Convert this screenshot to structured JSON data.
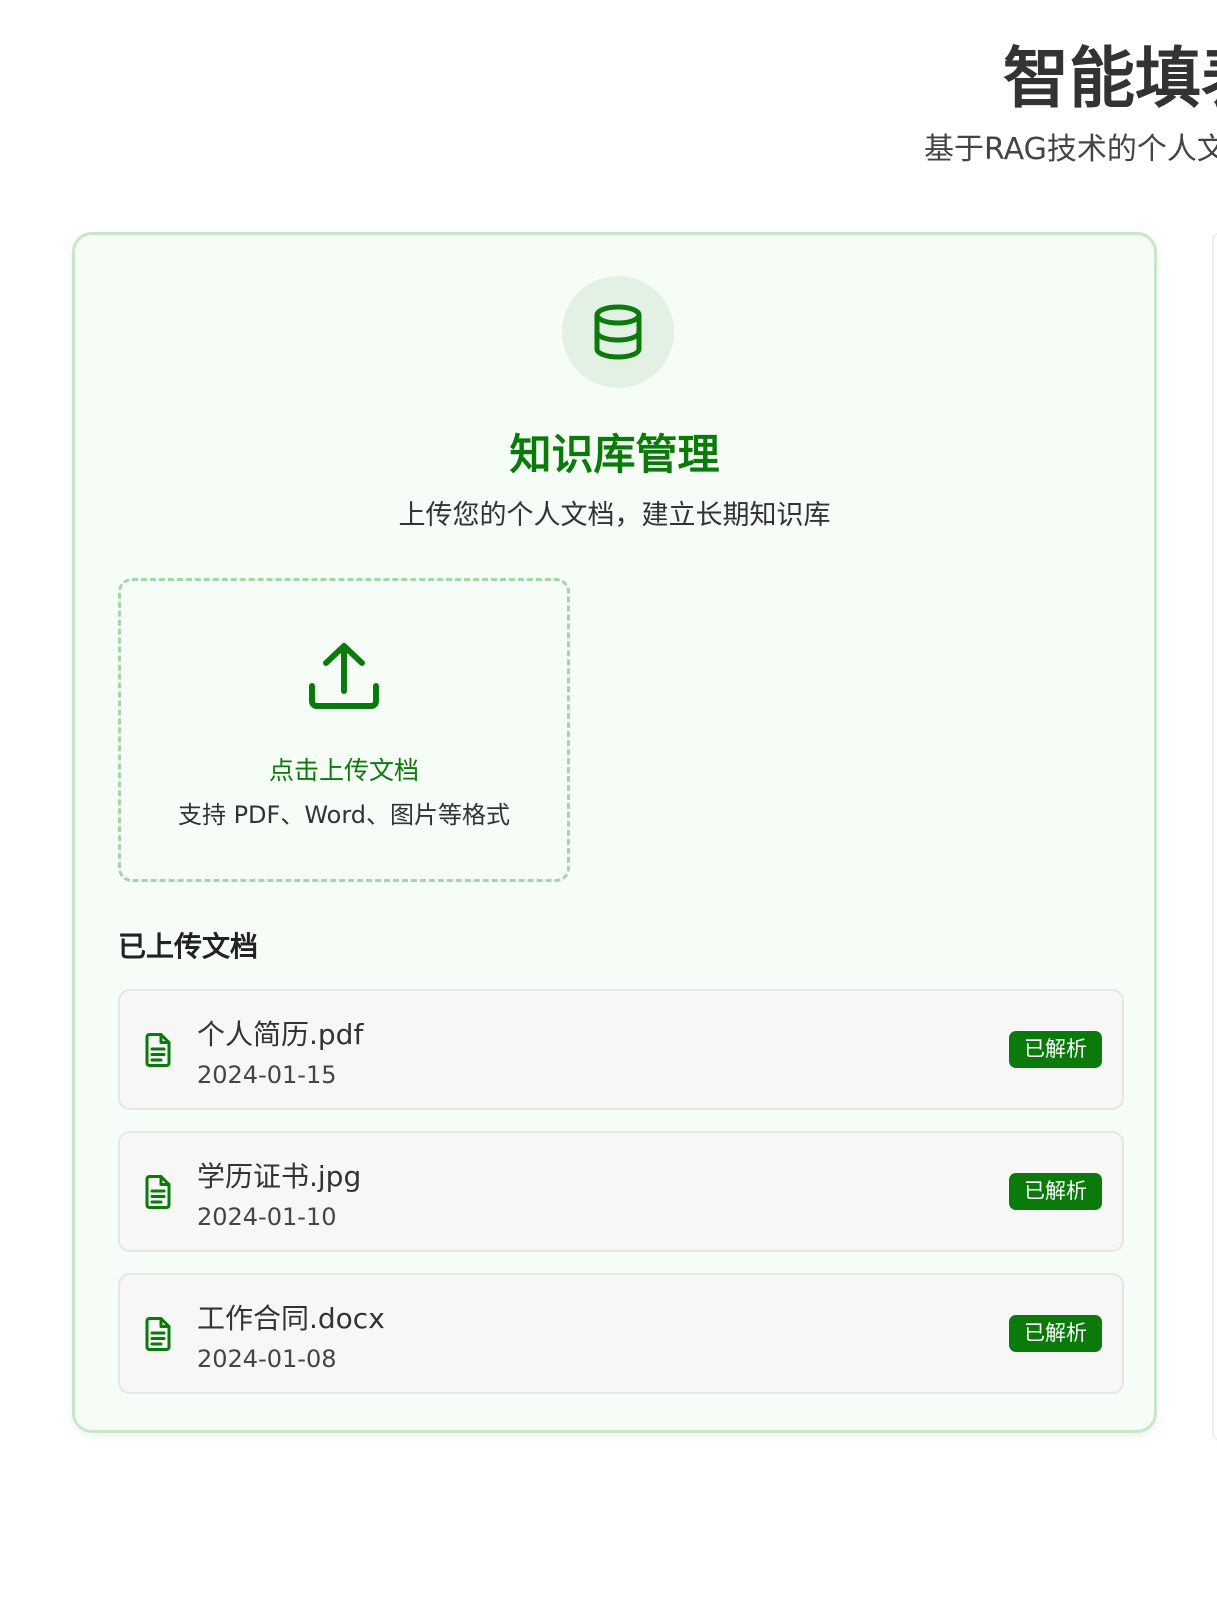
{
  "header": {
    "title": "智能填表",
    "subtitle": "基于RAG技术的个人文"
  },
  "knowledge_base": {
    "icon": "database-icon",
    "title": "知识库管理",
    "subtitle": "上传您的个人文档，建立长期知识库",
    "upload": {
      "icon": "upload-icon",
      "label": "点击上传文档",
      "hint": "支持 PDF、Word、图片等格式"
    },
    "documents_heading": "已上传文档",
    "documents": [
      {
        "name": "个人简历.pdf",
        "date": "2024-01-15",
        "status": "已解析",
        "icon": "document-icon"
      },
      {
        "name": "学历证书.jpg",
        "date": "2024-01-10",
        "status": "已解析",
        "icon": "document-icon"
      },
      {
        "name": "工作合同.docx",
        "date": "2024-01-08",
        "status": "已解析",
        "icon": "document-icon"
      }
    ]
  },
  "colors": {
    "brand": "#0a7b0a",
    "card_border": "#c8e6c9",
    "card_background": "#f6fcf6"
  }
}
